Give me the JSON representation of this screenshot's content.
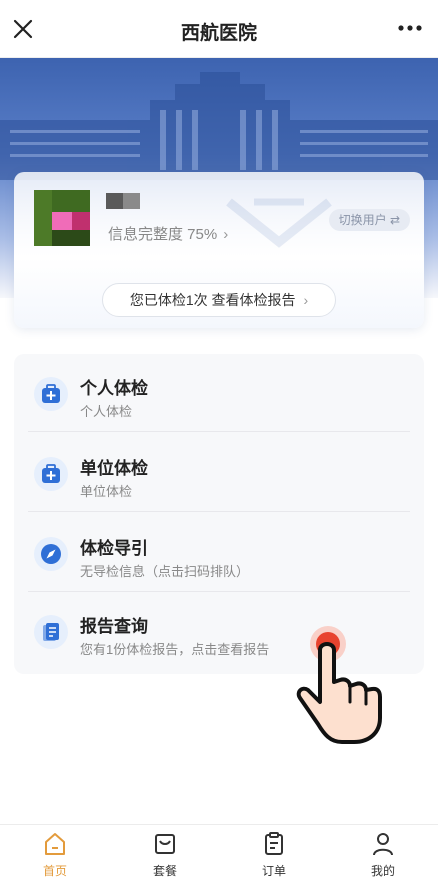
{
  "topbar": {
    "title": "西航医院",
    "close_icon": "close-icon",
    "more_icon": "more-dots-icon"
  },
  "profile": {
    "completion": "信息完整度 75%",
    "switch_user": "切换用户 ⇄",
    "exam_summary": "您已体检1次 查看体检报告"
  },
  "menu": [
    {
      "title": "个人体检",
      "subtitle": "个人体检",
      "icon": "medical-kit-icon"
    },
    {
      "title": "单位体检",
      "subtitle": "单位体检",
      "icon": "medical-kit-icon"
    },
    {
      "title": "体检导引",
      "subtitle": "无导检信息（点击扫码排队）",
      "icon": "compass-icon"
    },
    {
      "title": "报告查询",
      "subtitle": "您有1份体检报告，点击查看报告",
      "icon": "report-clipboard-icon"
    }
  ],
  "tabs": [
    {
      "label": "首页",
      "icon": "home-icon",
      "active": true
    },
    {
      "label": "套餐",
      "icon": "package-icon",
      "active": false
    },
    {
      "label": "订单",
      "icon": "order-clipboard-icon",
      "active": false
    },
    {
      "label": "我的",
      "icon": "user-icon",
      "active": false
    }
  ],
  "colors": {
    "accent": "#e39b3c",
    "icon_blue": "#2f6fd6",
    "banner_blue": "#3d63b0",
    "tap_red": "#e8432f"
  }
}
